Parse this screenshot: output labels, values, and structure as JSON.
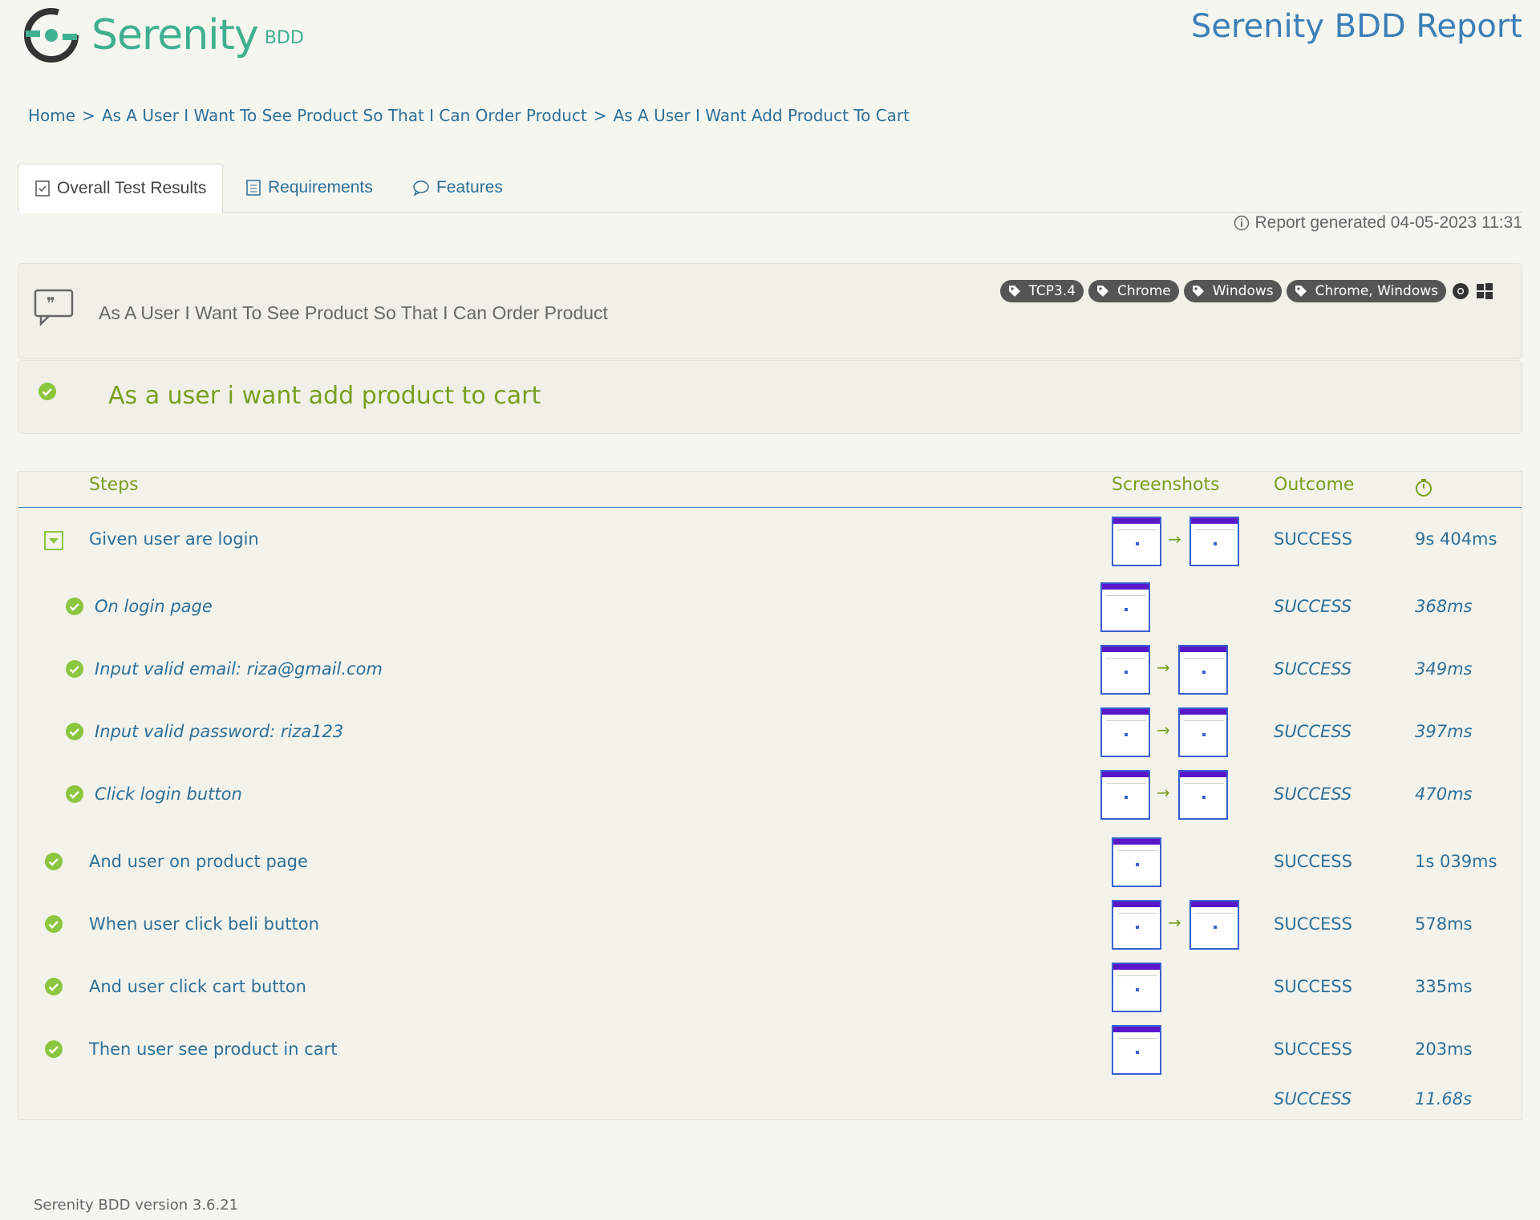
{
  "header": {
    "logo_text": "Serenity",
    "logo_sub": "BDD",
    "report_title": "Serenity BDD Report"
  },
  "breadcrumb": {
    "home": "Home",
    "sep": ">",
    "level1": "As A User I Want To See Product So That I Can Order Product",
    "level2": "As A User I Want Add Product To Cart"
  },
  "tabs": [
    {
      "label": "Overall Test Results"
    },
    {
      "label": "Requirements"
    },
    {
      "label": "Features"
    }
  ],
  "report_generated": "Report generated 04-05-2023 11:31",
  "requirement": {
    "title": "As A User I Want To See Product So That I Can Order Product",
    "tags": [
      "TCP3.4",
      "Chrome",
      "Windows",
      "Chrome, Windows"
    ]
  },
  "scenario": {
    "title": "As a user i want add product to cart"
  },
  "table": {
    "headers": {
      "steps": "Steps",
      "screenshots": "Screenshots",
      "outcome": "Outcome"
    },
    "rows": [
      {
        "label": "Given user are login",
        "outcome": "SUCCESS",
        "duration": "9s 404ms",
        "sub": false
      },
      {
        "label": "On login page",
        "outcome": "SUCCESS",
        "duration": "368ms",
        "sub": true
      },
      {
        "label": "Input valid email: riza@gmail.com",
        "outcome": "SUCCESS",
        "duration": "349ms",
        "sub": true
      },
      {
        "label": "Input valid password: riza123",
        "outcome": "SUCCESS",
        "duration": "397ms",
        "sub": true
      },
      {
        "label": "Click login button",
        "outcome": "SUCCESS",
        "duration": "470ms",
        "sub": true
      },
      {
        "label": "And user on product page",
        "outcome": "SUCCESS",
        "duration": "1s 039ms",
        "sub": false
      },
      {
        "label": "When user click beli button",
        "outcome": "SUCCESS",
        "duration": "578ms",
        "sub": false
      },
      {
        "label": "And user click cart button",
        "outcome": "SUCCESS",
        "duration": "335ms",
        "sub": false
      },
      {
        "label": "Then user see product in cart",
        "outcome": "SUCCESS",
        "duration": "203ms",
        "sub": false
      }
    ],
    "total": {
      "outcome": "SUCCESS",
      "duration": "11.68s"
    }
  },
  "footer": "Serenity BDD version 3.6.21",
  "colors": {
    "accent_green": "#7a9e1e",
    "link_blue": "#2f6f97",
    "check_green": "#8cc63f"
  }
}
